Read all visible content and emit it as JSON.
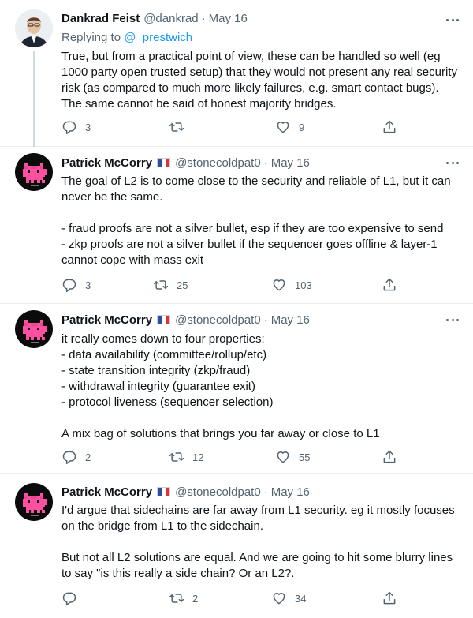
{
  "tweets": [
    {
      "name": "Dankrad Feist",
      "handle": "@dankrad",
      "dot": "·",
      "date": "May 16",
      "replying_prefix": "Replying to ",
      "replying_to": "@_prestwich",
      "lines": [
        "True, but from a practical point of view, these can be handled so well (eg",
        "1000 party open trusted setup) that they would not present any real security",
        "risk (as compared to much more likely failures, e.g. smart contact bugs).",
        "The same cannot be said of honest majority bridges."
      ],
      "replies": "3",
      "retweets": "",
      "likes": "9"
    },
    {
      "name": "Patrick McCorry",
      "handle": "@stonecoldpat0",
      "dot": "·",
      "date": "May 16",
      "lines": [
        "The goal of L2 is to come close to the security and reliable of L1, but it can",
        "never be the same.",
        "",
        "- fraud proofs are not a silver bullet, esp if they are too expensive to send",
        "- zkp proofs are not a silver bullet if the sequencer goes offline & layer-1",
        "cannot cope with mass exit"
      ],
      "replies": "3",
      "retweets": "25",
      "likes": "103"
    },
    {
      "name": "Patrick McCorry",
      "handle": "@stonecoldpat0",
      "dot": "·",
      "date": "May 16",
      "lines": [
        "it really comes down to four properties:",
        "- data availability (committee/rollup/etc)",
        "- state transition integrity (zkp/fraud)",
        "- withdrawal integrity (guarantee exit)",
        "- protocol liveness (sequencer selection)",
        "",
        "A mix bag of solutions that brings you far away or close to L1"
      ],
      "replies": "2",
      "retweets": "12",
      "likes": "55"
    },
    {
      "name": "Patrick McCorry",
      "handle": "@stonecoldpat0",
      "dot": "·",
      "date": "May 16",
      "lines": [
        "I'd argue that sidechains are far away from L1 security. eg it mostly focuses",
        "on the bridge from L1 to the sidechain.",
        "",
        "But not all L2 solutions are equal. And we are going to hit some blurry lines",
        "to say \"is this really a side chain? Or an L2?."
      ],
      "replies": "",
      "retweets": "2",
      "likes": "34"
    }
  ],
  "colors": {
    "text": "#0f1419",
    "muted": "#536471",
    "link": "#1d9bf0",
    "divider": "#e6ecf0",
    "avatar_cat": "#ff4fa0"
  },
  "icons": [
    "reply-icon",
    "retweet-icon",
    "like-icon",
    "share-icon",
    "more-icon",
    "france-flag-icon"
  ]
}
